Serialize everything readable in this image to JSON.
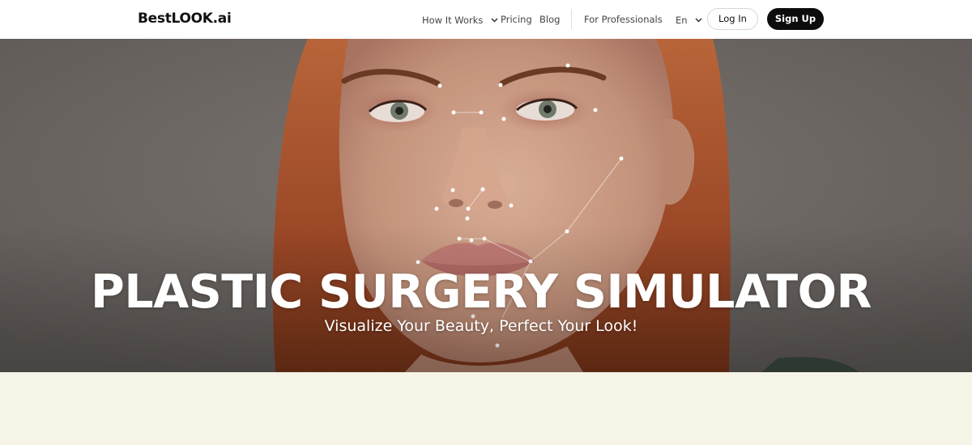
{
  "header": {
    "logo": "BestLOOK.ai",
    "nav": {
      "how_it_works": "How It Works",
      "pricing": "Pricing",
      "blog": "Blog",
      "for_professionals": "For Professionals",
      "language": "En"
    },
    "login_label": "Log In",
    "signup_label": "Sign Up"
  },
  "hero": {
    "title": "PLASTIC SURGERY SIMULATOR",
    "subtitle": "Visualize Your Beauty, Perfect Your Look!",
    "image_icon": "face-photo-with-landmarks"
  },
  "colors": {
    "nav_bg": "#ffffff",
    "signup_bg": "#0c0c0c",
    "hero_bg": "#6f6a67",
    "hair": "#a4512c",
    "skin": "#c99b84",
    "section_bg": "#f5f4e7"
  }
}
